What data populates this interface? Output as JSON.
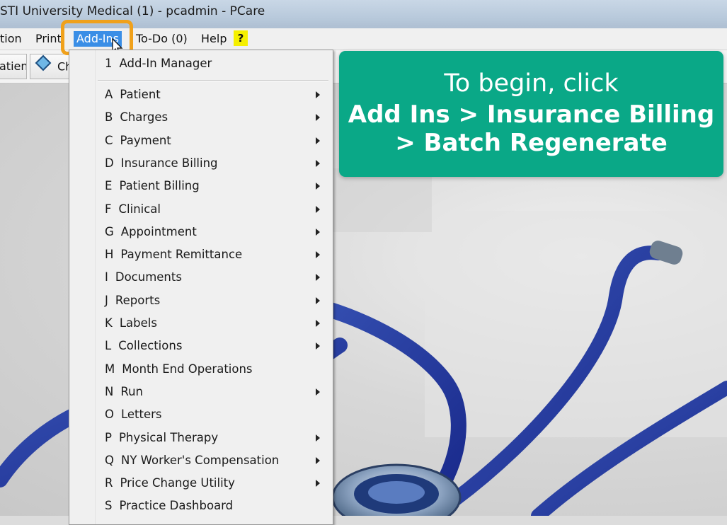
{
  "window": {
    "title": "STI University Medical (1) - pcadmin - PCare"
  },
  "menubar": {
    "items": [
      "tion",
      "Print",
      "Add-Ins",
      "To-Do (0)",
      "Help"
    ],
    "help_badge": "?"
  },
  "toolbar": {
    "items": [
      "atient",
      "Ch"
    ]
  },
  "addins_menu": {
    "manager": {
      "key": "1",
      "label": "Add-In Manager"
    },
    "items": [
      {
        "key": "A",
        "label": "Patient",
        "submenu": true
      },
      {
        "key": "B",
        "label": "Charges",
        "submenu": true
      },
      {
        "key": "C",
        "label": "Payment",
        "submenu": true
      },
      {
        "key": "D",
        "label": "Insurance Billing",
        "submenu": true
      },
      {
        "key": "E",
        "label": "Patient Billing",
        "submenu": true
      },
      {
        "key": "F",
        "label": "Clinical",
        "submenu": true
      },
      {
        "key": "G",
        "label": "Appointment",
        "submenu": true
      },
      {
        "key": "H",
        "label": "Payment Remittance",
        "submenu": true
      },
      {
        "key": "I",
        "label": "Documents",
        "submenu": true
      },
      {
        "key": "J",
        "label": "Reports",
        "submenu": true
      },
      {
        "key": "K",
        "label": "Labels",
        "submenu": true
      },
      {
        "key": "L",
        "label": "Collections",
        "submenu": true
      },
      {
        "key": "M",
        "label": "Month End Operations",
        "submenu": false
      },
      {
        "key": "N",
        "label": "Run",
        "submenu": true
      },
      {
        "key": "O",
        "label": "Letters",
        "submenu": false
      },
      {
        "key": "P",
        "label": "Physical Therapy",
        "submenu": true
      },
      {
        "key": "Q",
        "label": "NY Worker's Compensation",
        "submenu": true
      },
      {
        "key": "R",
        "label": "Price Change Utility",
        "submenu": true
      },
      {
        "key": "S",
        "label": "Practice Dashboard",
        "submenu": false
      }
    ]
  },
  "callout": {
    "line1": "To begin, click",
    "line2": "Add Ins > Insurance Billing",
    "line3": "> Batch Regenerate",
    "color": "#0aa887"
  },
  "highlight_color": "#f0a11b"
}
